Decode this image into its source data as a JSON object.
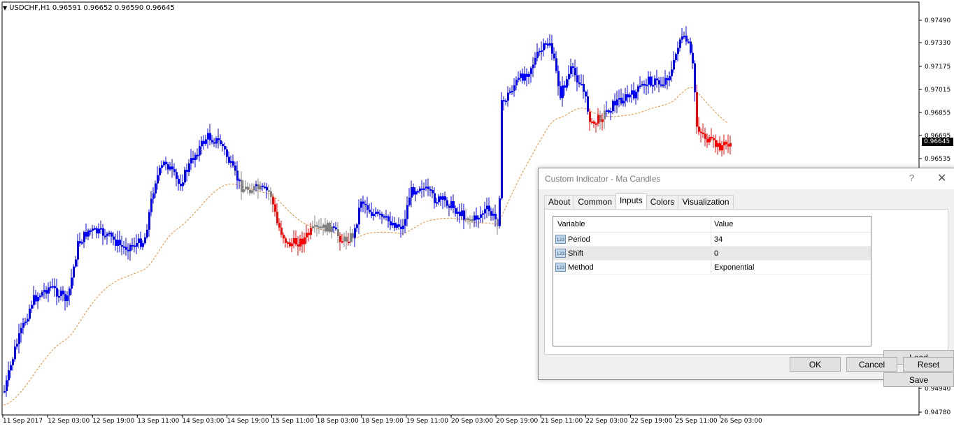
{
  "chart": {
    "symbol_label": "USDCHF,H1",
    "ohlc": "0.96591 0.96652 0.96590 0.96645",
    "current_price": "0.96645",
    "price_ticks": [
      "0.97490",
      "0.97330",
      "0.97175",
      "0.97015",
      "0.96855",
      "0.96695",
      "0.96535",
      "0.94940",
      "0.94780"
    ],
    "time_labels": [
      "11 Sep 2017",
      "12 Sep 03:00",
      "12 Sep 19:00",
      "13 Sep 11:00",
      "14 Sep 03:00",
      "14 Sep 19:00",
      "15 Sep 11:00",
      "18 Sep 03:00",
      "18 Sep 19:00",
      "19 Sep 11:00",
      "20 Sep 03:00",
      "20 Sep 19:00",
      "21 Sep 11:00",
      "22 Sep 03:00",
      "22 Sep 19:00",
      "25 Sep 11:00",
      "26 Sep 03:00"
    ],
    "colors": {
      "bull": "#0000ff",
      "bear": "#ff0000",
      "neutral": "#808080",
      "ma": "#e69138"
    }
  },
  "dialog": {
    "title": "Custom Indicator - Ma Candles",
    "help": "?",
    "close": "✕",
    "tabs": [
      "About",
      "Common",
      "Inputs",
      "Colors",
      "Visualization"
    ],
    "active_tab": "Inputs",
    "columns": {
      "variable": "Variable",
      "value": "Value"
    },
    "inputs": [
      {
        "icon": "123",
        "name": "Period",
        "value": "34"
      },
      {
        "icon": "123",
        "name": "Shift",
        "value": "0"
      },
      {
        "icon": "123",
        "name": "Method",
        "value": "Exponential"
      }
    ],
    "buttons": {
      "load": "Load",
      "save": "Save",
      "ok": "OK",
      "cancel": "Cancel",
      "reset": "Reset"
    }
  }
}
